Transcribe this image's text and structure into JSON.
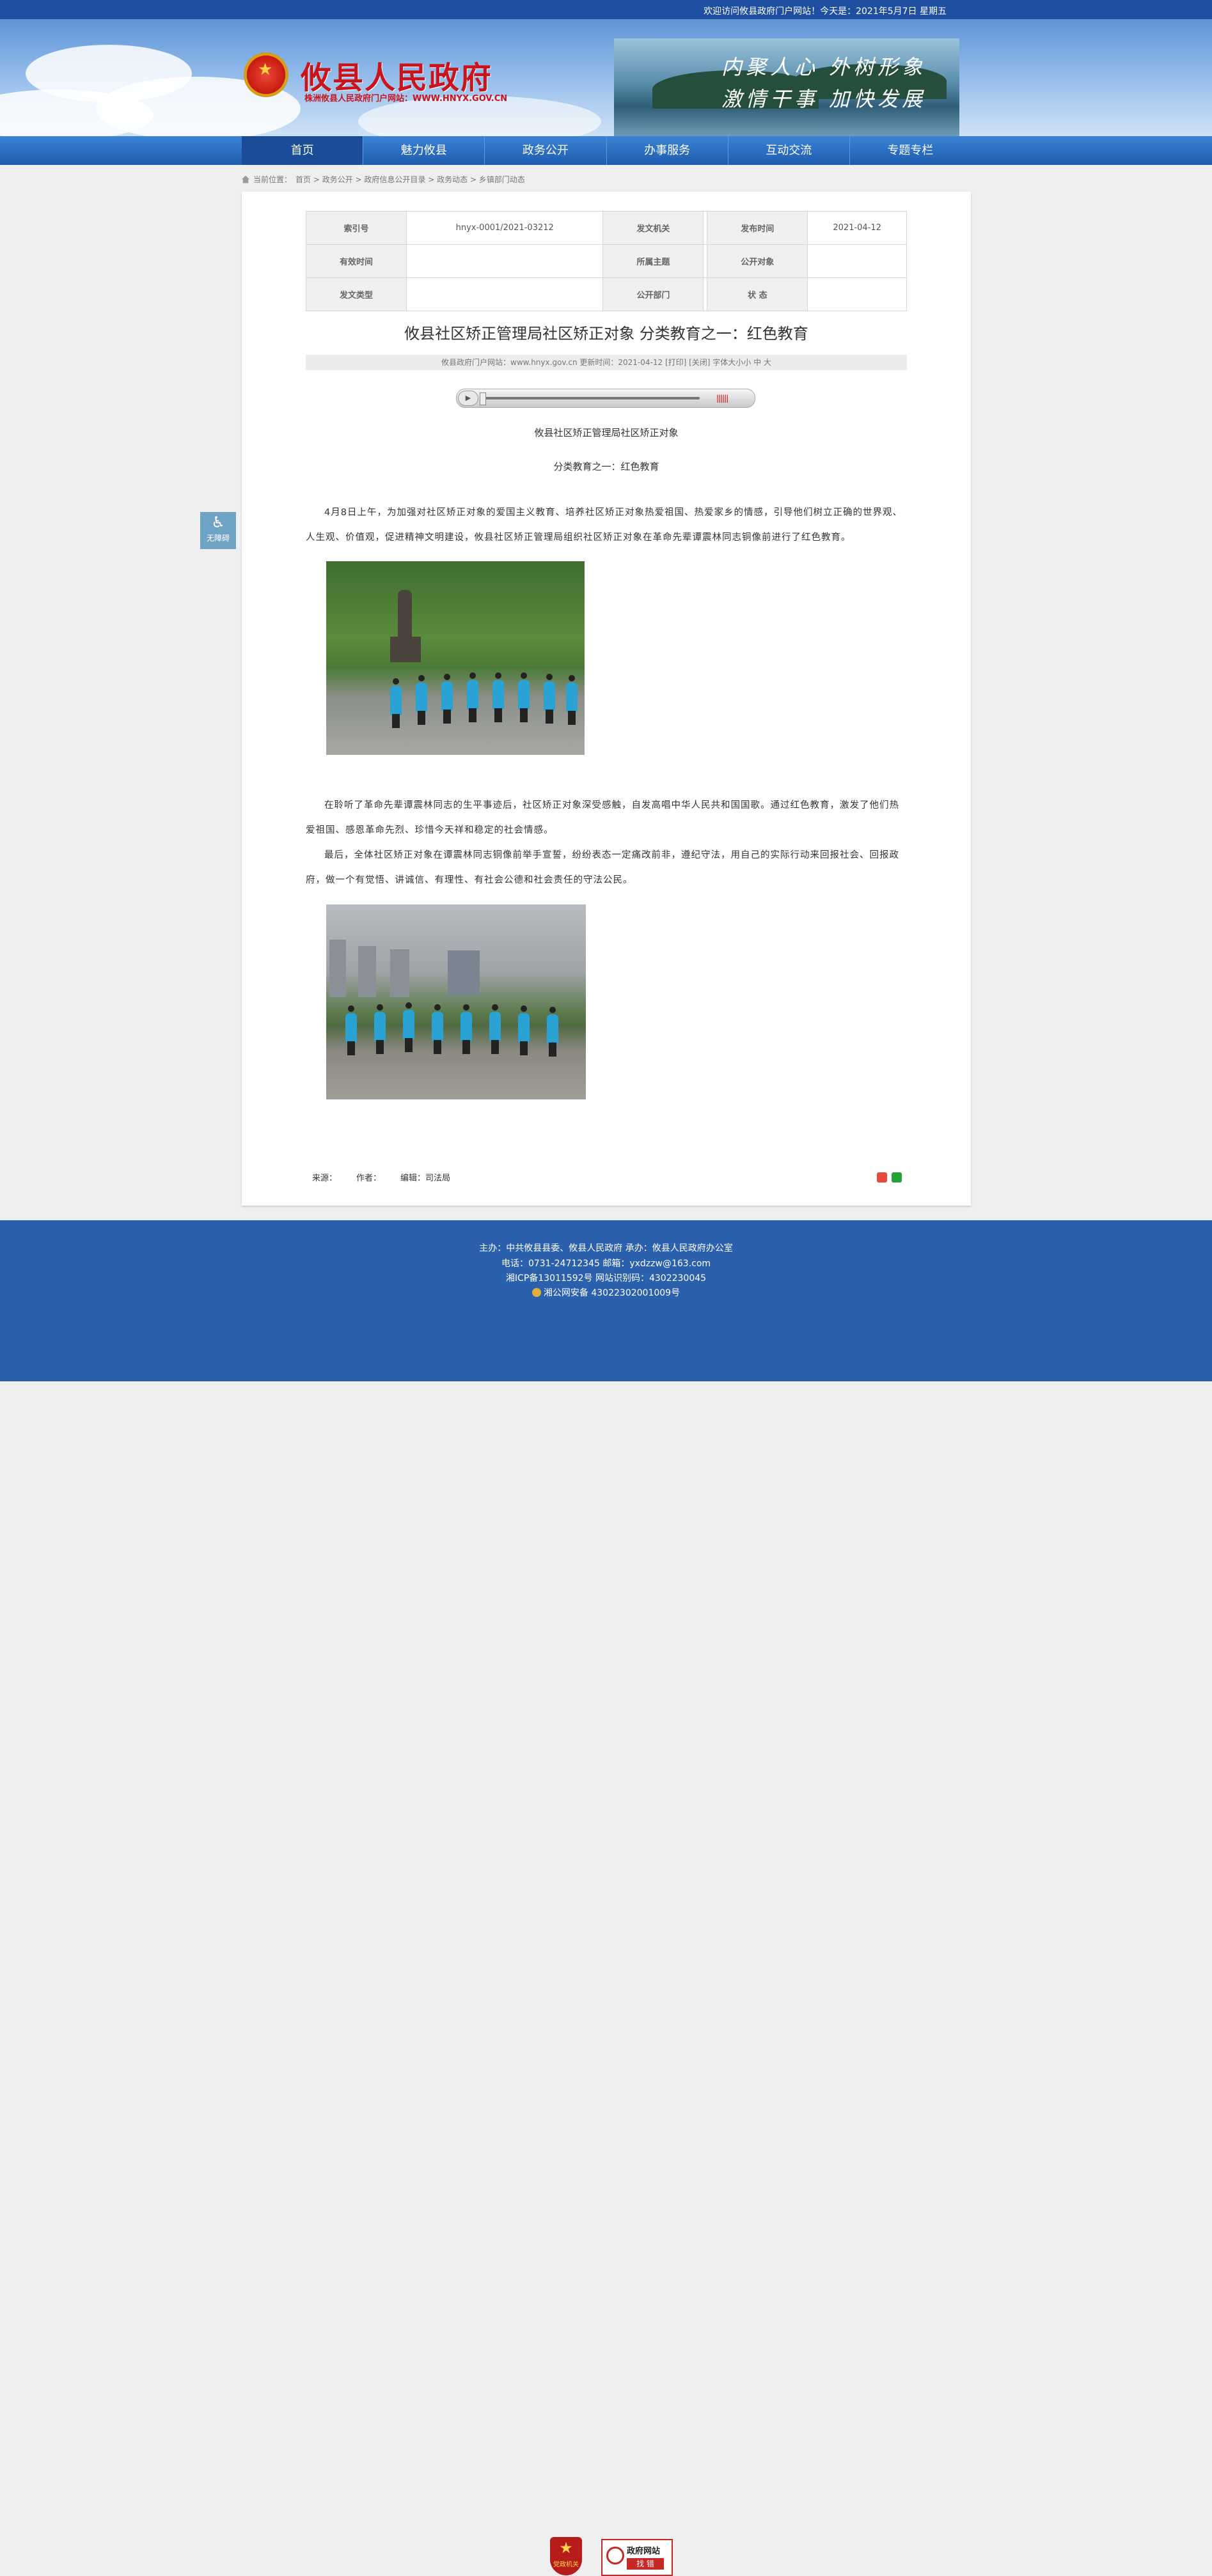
{
  "topbar": {
    "welcome": "欢迎访问攸县政府门户网站！今天是：2021年5月7日 星期五"
  },
  "header": {
    "site_title": "攸县人民政府",
    "site_sub": "株洲攸县人民政府门户网站：WWW.HNYX.GOV.CN",
    "slogan_1": "内聚人心  外树形象",
    "slogan_2": "激情干事  加快发展"
  },
  "nav": {
    "items": [
      "首页",
      "魅力攸县",
      "政务公开",
      "办事服务",
      "互动交流",
      "专题专栏"
    ],
    "active": 0
  },
  "breadcrumb": {
    "prefix": "当前位置：",
    "path": "首页 > 政务公开 > 政府信息公开目录 > 政务动态 > 乡镇部门动态"
  },
  "meta_table": {
    "rows": [
      [
        "索引号",
        "hnyx-0001/2021-03212",
        "发文机关",
        "",
        "发布时间",
        "2021-04-12"
      ],
      [
        "有效时间",
        "",
        "所属主题",
        "",
        "公开对象",
        ""
      ],
      [
        "发文类型",
        "",
        "公开部门",
        "",
        "状 态",
        ""
      ]
    ]
  },
  "article": {
    "title": "攸县社区矫正管理局社区矫正对象 分类教育之一：红色教育",
    "info": "攸县政府门户网站：www.hnyx.gov.cn  更新时间：2021-04-12  [打印] [关闭]  字体大小小 中 大",
    "heading_1": "攸县社区矫正管理局社区矫正对象",
    "heading_2": "分类教育之一：红色教育",
    "para_1": "4月8日上午，为加强对社区矫正对象的爱国主义教育、培养社区矫正对象热爱祖国、热爱家乡的情感，引导他们树立正确的世界观、人生观、价值观，促进精神文明建设，攸县社区矫正管理局组织社区矫正对象在革命先辈谭震林同志铜像前进行了红色教育。",
    "para_2": "在聆听了革命先辈谭震林同志的生平事迹后，社区矫正对象深受感触，自发高唱中华人民共和国国歌。通过红色教育，激发了他们热爱祖国、感恩革命先烈、珍惜今天祥和稳定的社会情感。",
    "para_3": "最后，全体社区矫正对象在谭震林同志铜像前举手宣誓，纷纷表态一定痛改前非，遵纪守法，用自己的实际行动来回报社会、回报政府，做一个有觉悟、讲诚信、有理性、有社会公德和社会责任的守法公民。",
    "source_label": "来源：",
    "author_label": "作者：",
    "editor": "编辑：司法局"
  },
  "accessibility": {
    "label": "无障碍"
  },
  "footer": {
    "line_1": "主办：中共攸县县委、攸县人民政府 承办：攸县人民政府办公室",
    "line_2": "电话：0731-24712345 邮箱：yxdzzw@163.com",
    "line_3": "湘ICP备13011592号   网站识别码：4302230045",
    "line_4": "湘公网安备 43022302001009号",
    "badge_1": "党政机关",
    "badge_2_top": "政府网站",
    "badge_2_bottom": "找 错"
  }
}
